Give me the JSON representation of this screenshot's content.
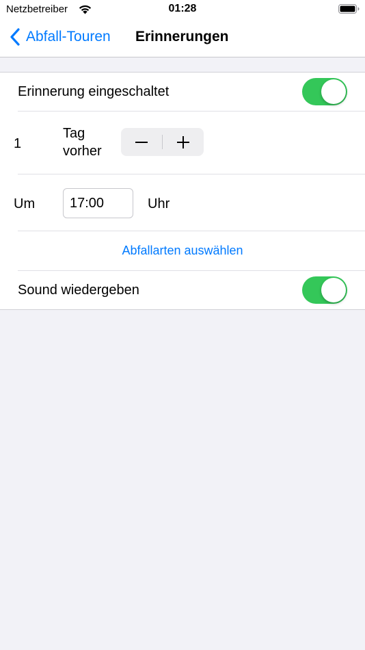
{
  "status_bar": {
    "carrier": "Netzbetreiber",
    "time": "01:28"
  },
  "nav": {
    "back_label": "Abfall-Touren",
    "title": "Erinnerungen"
  },
  "settings": {
    "reminder_label": "Erinnerung eingeschaltet",
    "reminder_on": true,
    "days_value": "1",
    "days_label_line1": "Tag",
    "days_label_line2": "vorher",
    "time_prefix": "Um",
    "time_value": "17:00",
    "time_suffix": "Uhr",
    "waste_types_link": "Abfallarten auswählen",
    "sound_label": "Sound wiedergeben",
    "sound_on": true
  },
  "colors": {
    "accent": "#007aff",
    "toggle_on": "#34c759",
    "background": "#f2f2f7"
  }
}
